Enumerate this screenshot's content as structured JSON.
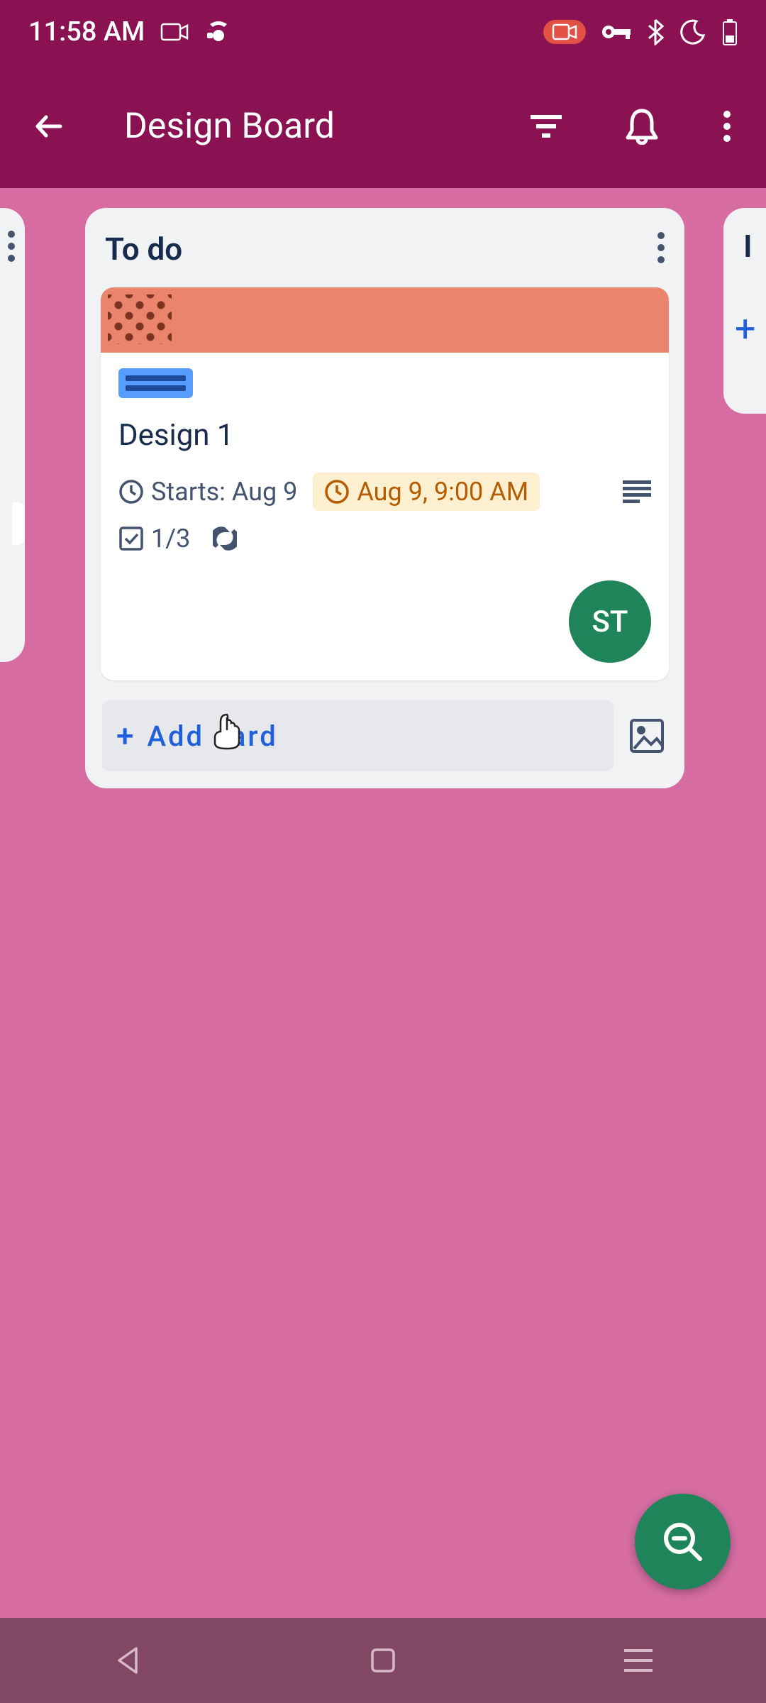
{
  "status": {
    "time": "11:58 AM"
  },
  "appbar": {
    "title": "Design Board"
  },
  "list": {
    "title": "To do",
    "card": {
      "title": "Design 1",
      "startsLabel": "Starts: Aug 9",
      "dueLabel": "Aug 9, 9:00 AM",
      "checklist": "1/3",
      "memberInitials": "ST"
    },
    "addCardLabel": "Add card"
  },
  "listLeft": {
    "title": ""
  },
  "listRight": {
    "title": "I"
  }
}
